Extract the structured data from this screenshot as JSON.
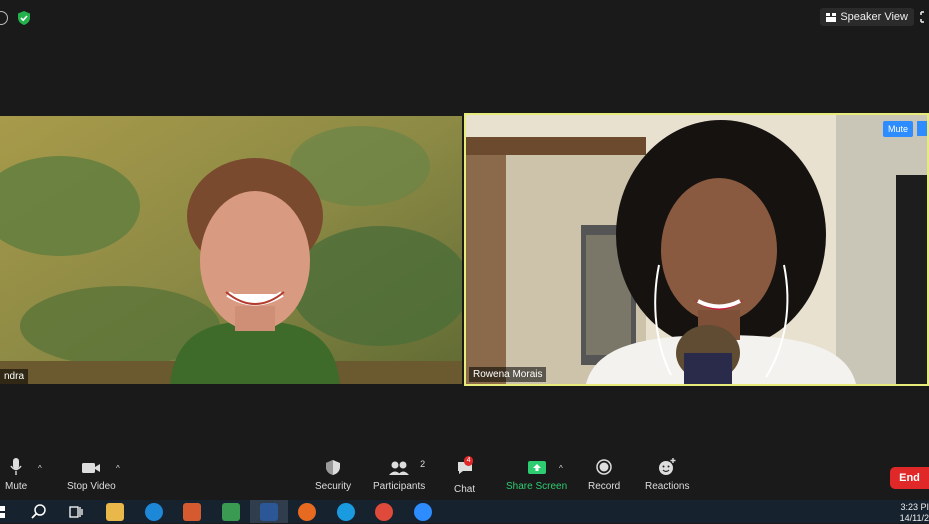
{
  "top_bar": {
    "speaker_view_label": "Speaker View",
    "icons": [
      "info-icon",
      "shield-check-icon",
      "fullscreen-icon"
    ]
  },
  "participants": [
    {
      "name": "ndra",
      "speaking": false
    },
    {
      "name": "Rowena Morais",
      "speaking": true
    }
  ],
  "tile_controls": {
    "mute_label": "Mute"
  },
  "toolbar": {
    "mute_label": "Mute",
    "stop_video_label": "Stop Video",
    "security_label": "Security",
    "participants_label": "Participants",
    "participants_count": "2",
    "chat_label": "Chat",
    "chat_badge": "4",
    "share_screen_label": "Share Screen",
    "record_label": "Record",
    "reactions_label": "Reactions",
    "end_label": "End",
    "share_color": "#2ecc71",
    "end_color": "#e02828"
  },
  "taskbar": {
    "clock_time": "3:23 PI",
    "clock_date": "14/11/2"
  }
}
